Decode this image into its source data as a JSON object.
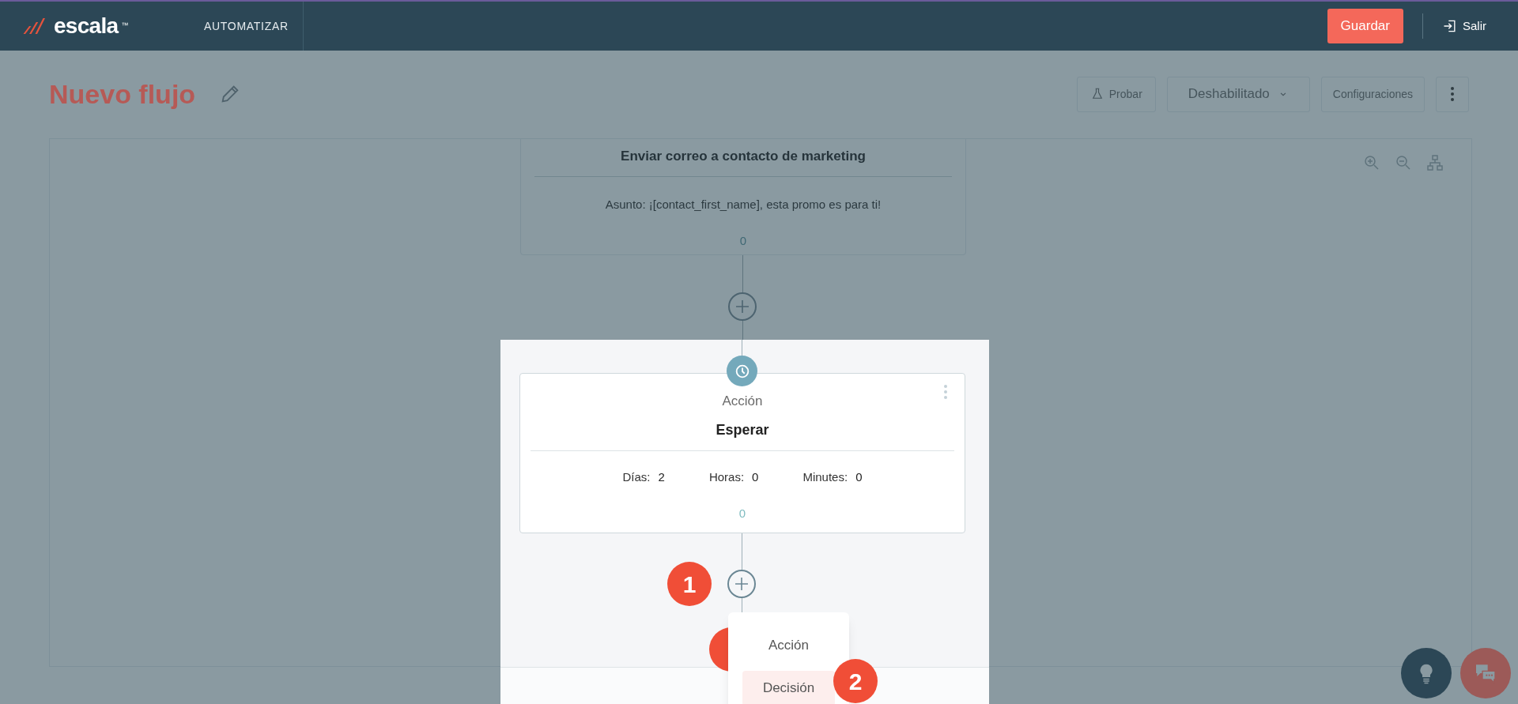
{
  "header": {
    "logo": "escala",
    "logo_mark": "™",
    "section": "AUTOMATIZAR",
    "save_button": "Guardar",
    "exit_button": "Salir"
  },
  "flow": {
    "title": "Nuevo flujo",
    "buttons": [
      {
        "kind": "test",
        "label": "Probar"
      },
      {
        "kind": "dropdown",
        "label": "Deshabilitado"
      },
      {
        "kind": "plain",
        "label": "Configuraciones"
      },
      {
        "kind": "more"
      }
    ]
  },
  "nodes": [
    {
      "kind": "email",
      "title": "Enviar correo a contacto de marketing",
      "subject_label": "Asunto:",
      "subject": "¡[contact_first_name], esta promo es para ti!",
      "count": "0"
    },
    {
      "kind": "wait",
      "type_label": "Acción",
      "title": "Esperar",
      "fields": [
        {
          "label": "Días:",
          "value": "2"
        },
        {
          "label": "Horas:",
          "value": "0"
        },
        {
          "label": "Minutes:",
          "value": "0"
        }
      ],
      "count": "0"
    }
  ],
  "add_menu": {
    "items": [
      {
        "label": "Acción",
        "selected": false
      },
      {
        "label": "Decisión",
        "selected": true
      }
    ]
  },
  "step_badges": [
    "1",
    "2"
  ]
}
